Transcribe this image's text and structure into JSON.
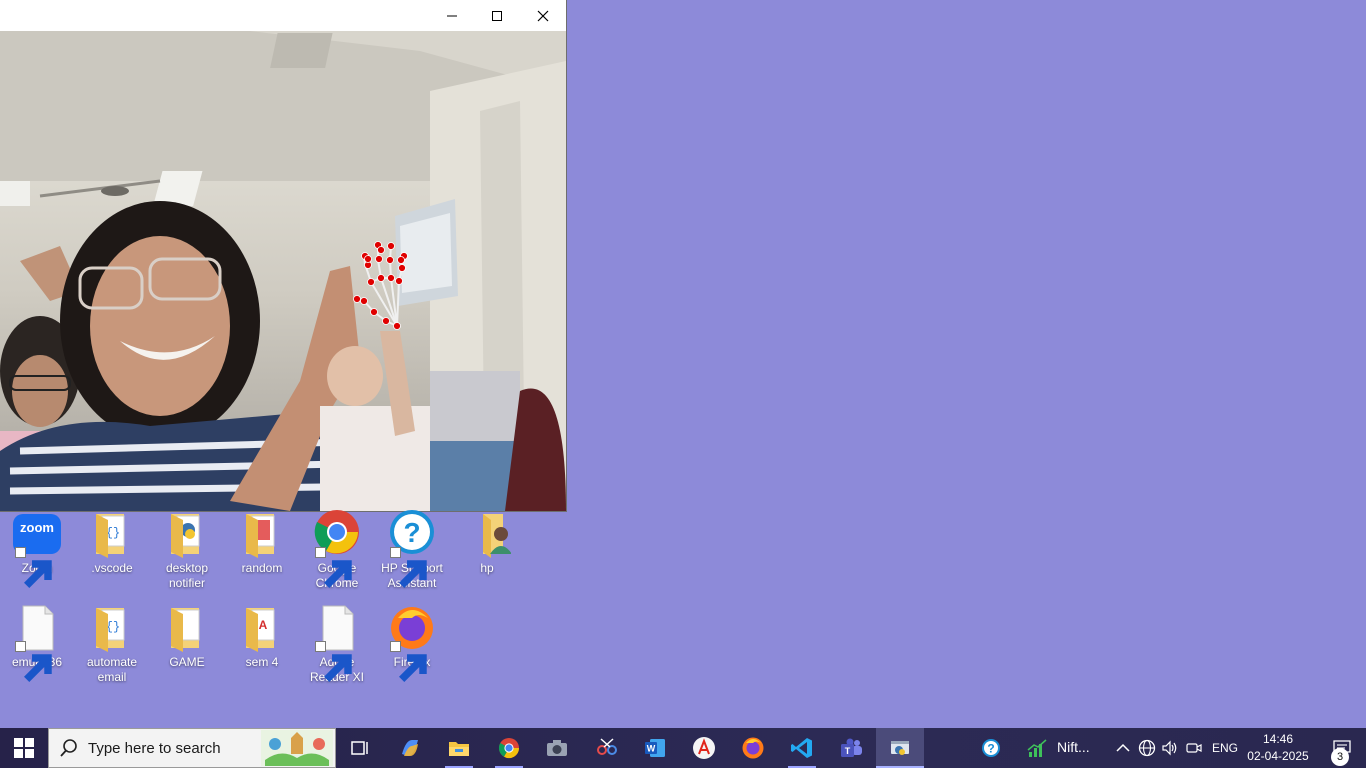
{
  "window": {
    "minimize_label": "Minimize",
    "maximize_label": "Maximize",
    "close_label": "Close"
  },
  "desktop": {
    "row1": [
      {
        "label": "Zoom",
        "icon": "zoom-icon",
        "shortcut": true
      },
      {
        "label": ".vscode",
        "icon": "folder-code-icon",
        "shortcut": false
      },
      {
        "label": "desktop notifier",
        "icon": "folder-python-icon",
        "shortcut": false
      },
      {
        "label": "random",
        "icon": "folder-icon",
        "shortcut": false
      },
      {
        "label": "Google Chrome",
        "icon": "chrome-icon",
        "shortcut": true
      },
      {
        "label": "HP Support Assistant",
        "icon": "hp-support-icon",
        "shortcut": true
      },
      {
        "label": "hp",
        "icon": "user-folder-icon",
        "shortcut": false
      }
    ],
    "row2": [
      {
        "label": "emu8086",
        "icon": "file-icon",
        "shortcut": true
      },
      {
        "label": "automate email",
        "icon": "folder-code-icon",
        "shortcut": false
      },
      {
        "label": "GAME",
        "icon": "folder-icon",
        "shortcut": false
      },
      {
        "label": "sem 4",
        "icon": "folder-pdf-icon",
        "shortcut": false
      },
      {
        "label": "Adobe Reader XI",
        "icon": "file-icon",
        "shortcut": true
      },
      {
        "label": "Firefox",
        "icon": "firefox-icon",
        "shortcut": true
      }
    ]
  },
  "taskbar": {
    "search_placeholder": "Type here to search",
    "pinned": [
      "task-view-icon",
      "copilot-icon",
      "file-explorer-icon",
      "chrome-icon",
      "camera-icon",
      "snipping-tool-icon",
      "word-icon",
      "acrobat-icon",
      "firefox-icon",
      "vscode-icon",
      "teams-icon",
      "python-icon"
    ],
    "widget_label": "Nift...",
    "language": "ENG",
    "time": "14:46",
    "date": "02-04-2025",
    "notification_count": "3"
  },
  "colors": {
    "desktop_bg": "#8d8ad9",
    "taskbar_bg": "#2a2850",
    "search_bg": "#f3f3f3",
    "landmark_point": "#e00000"
  }
}
